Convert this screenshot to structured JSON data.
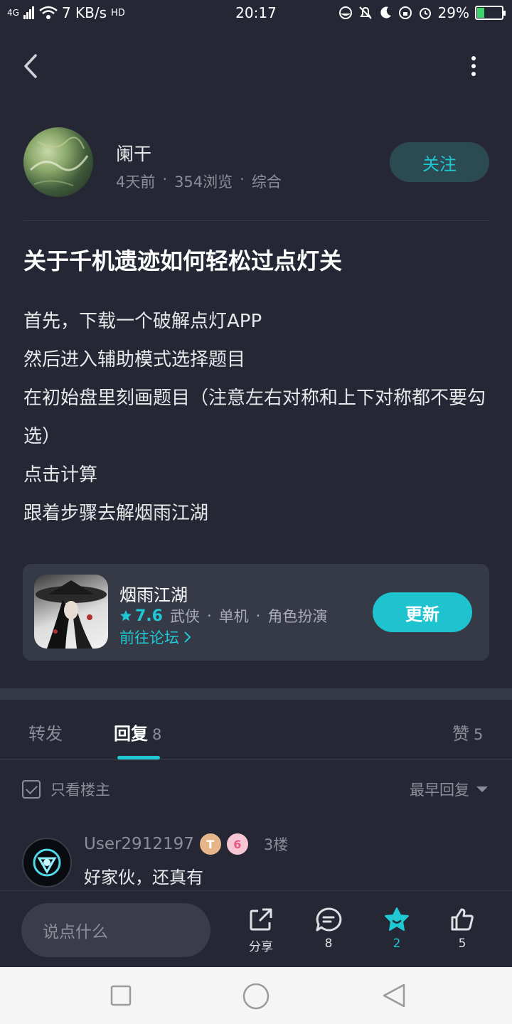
{
  "status_bar": {
    "signal": "4G",
    "speed": "7 KB/s",
    "hd": "HD",
    "time": "20:17",
    "battery": "29%",
    "battery_level": 0.29
  },
  "author": {
    "name": "阑干",
    "time": "4天前",
    "views": "354浏览",
    "category": "综合",
    "dot": "·",
    "follow_label": "关注"
  },
  "post": {
    "title": "关于千机遗迹如何轻松过点灯关",
    "lines": [
      "首先，下载一个破解点灯APP",
      "然后进入辅助模式选择题目",
      "在初始盘里刻画题目（注意左右对称和上下对称都不要勾选）",
      "点击计算",
      "跟着步骤去解烟雨江湖"
    ]
  },
  "game": {
    "name": "烟雨江湖",
    "rating": "7.6",
    "tags": [
      "武侠",
      "单机",
      "角色扮演"
    ],
    "dot": "·",
    "forum_link": "前往论坛",
    "update_label": "更新"
  },
  "tabs": {
    "repost": "转发",
    "reply": "回复",
    "reply_count": "8",
    "like": "赞",
    "like_count": "5"
  },
  "filter": {
    "only_author": "只看楼主",
    "sort": "最早回复"
  },
  "comment": {
    "user": "User2912197",
    "badge1": "T",
    "badge2": "6",
    "floor": "3楼",
    "text": "好家伙，还真有"
  },
  "bottom_bar": {
    "placeholder": "说点什么",
    "share": "分享",
    "reply_count": "8",
    "star_count": "2",
    "like_count": "5"
  },
  "colors": {
    "accent": "#1fc8d2",
    "background": "#252834",
    "card": "#363a47"
  }
}
